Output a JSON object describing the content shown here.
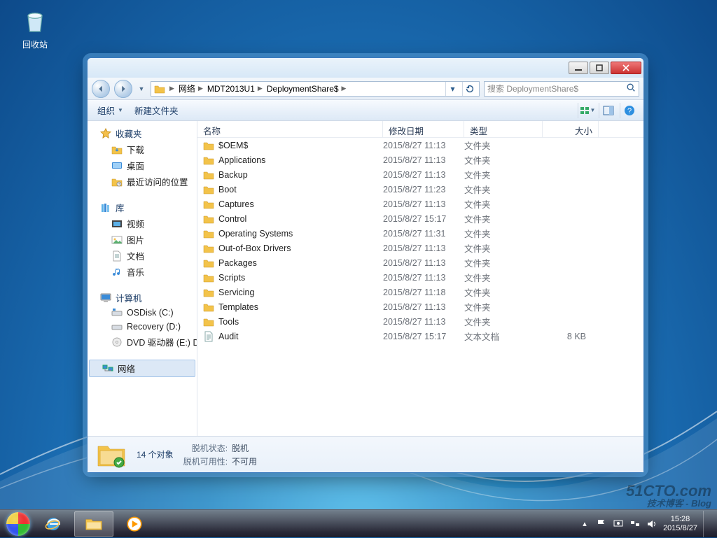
{
  "desktop": {
    "recycle_bin": "回收站"
  },
  "window": {
    "breadcrumb": {
      "network_icon": "network-icon",
      "parts": [
        "网络",
        "MDT2013U1",
        "DeploymentShare$"
      ]
    },
    "search_placeholder": "搜索 DeploymentShare$",
    "toolbar": {
      "organize": "组织",
      "new_folder": "新建文件夹"
    },
    "columns": {
      "name": "名称",
      "date": "修改日期",
      "type": "类型",
      "size": "大小"
    },
    "sidebar": {
      "favorites": {
        "label": "收藏夹",
        "items": [
          "下载",
          "桌面",
          "最近访问的位置"
        ]
      },
      "libraries": {
        "label": "库",
        "items": [
          "视频",
          "图片",
          "文档",
          "音乐"
        ]
      },
      "computer": {
        "label": "计算机",
        "items": [
          "OSDisk (C:)",
          "Recovery (D:)",
          "DVD 驱动器 (E:) DV"
        ]
      },
      "network": {
        "label": "网络"
      }
    },
    "files": [
      {
        "icon": "folder",
        "name": "$OEM$",
        "date": "2015/8/27 11:13",
        "type": "文件夹",
        "size": ""
      },
      {
        "icon": "folder",
        "name": "Applications",
        "date": "2015/8/27 11:13",
        "type": "文件夹",
        "size": ""
      },
      {
        "icon": "folder",
        "name": "Backup",
        "date": "2015/8/27 11:13",
        "type": "文件夹",
        "size": ""
      },
      {
        "icon": "folder",
        "name": "Boot",
        "date": "2015/8/27 11:23",
        "type": "文件夹",
        "size": ""
      },
      {
        "icon": "folder",
        "name": "Captures",
        "date": "2015/8/27 11:13",
        "type": "文件夹",
        "size": ""
      },
      {
        "icon": "folder",
        "name": "Control",
        "date": "2015/8/27 15:17",
        "type": "文件夹",
        "size": ""
      },
      {
        "icon": "folder",
        "name": "Operating Systems",
        "date": "2015/8/27 11:31",
        "type": "文件夹",
        "size": ""
      },
      {
        "icon": "folder",
        "name": "Out-of-Box Drivers",
        "date": "2015/8/27 11:13",
        "type": "文件夹",
        "size": ""
      },
      {
        "icon": "folder",
        "name": "Packages",
        "date": "2015/8/27 11:13",
        "type": "文件夹",
        "size": ""
      },
      {
        "icon": "folder",
        "name": "Scripts",
        "date": "2015/8/27 11:13",
        "type": "文件夹",
        "size": ""
      },
      {
        "icon": "folder",
        "name": "Servicing",
        "date": "2015/8/27 11:18",
        "type": "文件夹",
        "size": ""
      },
      {
        "icon": "folder",
        "name": "Templates",
        "date": "2015/8/27 11:13",
        "type": "文件夹",
        "size": ""
      },
      {
        "icon": "folder",
        "name": "Tools",
        "date": "2015/8/27 11:13",
        "type": "文件夹",
        "size": ""
      },
      {
        "icon": "text",
        "name": "Audit",
        "date": "2015/8/27 15:17",
        "type": "文本文档",
        "size": "8 KB"
      }
    ],
    "status": {
      "count": "14 个对象",
      "offline_state_k": "脱机状态:",
      "offline_state_v": "脱机",
      "offline_avail_k": "脱机可用性:",
      "offline_avail_v": "不可用"
    }
  },
  "taskbar": {
    "time": "15:28",
    "date": "2015/8/27"
  },
  "watermark": {
    "top": "51CTO.com",
    "sub": "技术博客 - Blog"
  }
}
